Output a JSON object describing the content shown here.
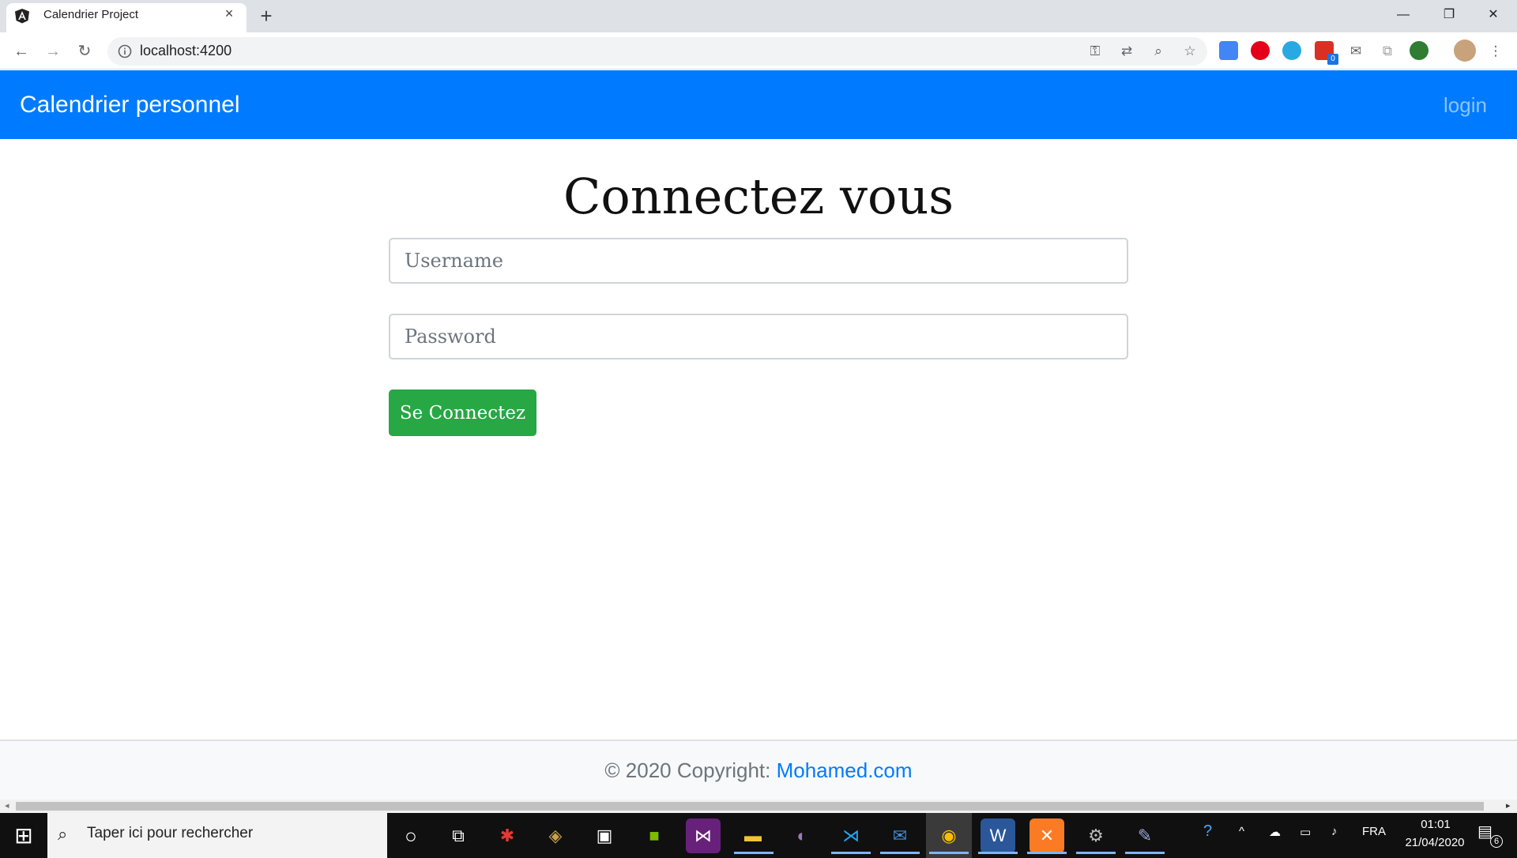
{
  "browser": {
    "tab_title": "Calendrier Project",
    "tab_close": "×",
    "new_tab": "+",
    "url": "localhost:4200",
    "window_controls": {
      "minimize": "—",
      "restore": "❐",
      "close": "✕"
    },
    "extension_badge": "0"
  },
  "navbar": {
    "brand": "Calendrier personnel",
    "login_link": "login"
  },
  "login_form": {
    "heading": "Connectez vous",
    "username_placeholder": "Username",
    "password_placeholder": "Password",
    "submit_label": "Se Connectez"
  },
  "footer": {
    "copyright_prefix": "© 2020 Copyright: ",
    "copyright_link": "Mohamed.com"
  },
  "taskbar": {
    "search_placeholder": "Taper ici pour rechercher",
    "language": "FRA",
    "time": "01:01",
    "date": "21/04/2020",
    "notification_count": "6"
  },
  "colors": {
    "navbar_bg": "#007bff",
    "submit_bg": "#28a745",
    "link": "#007bff"
  }
}
